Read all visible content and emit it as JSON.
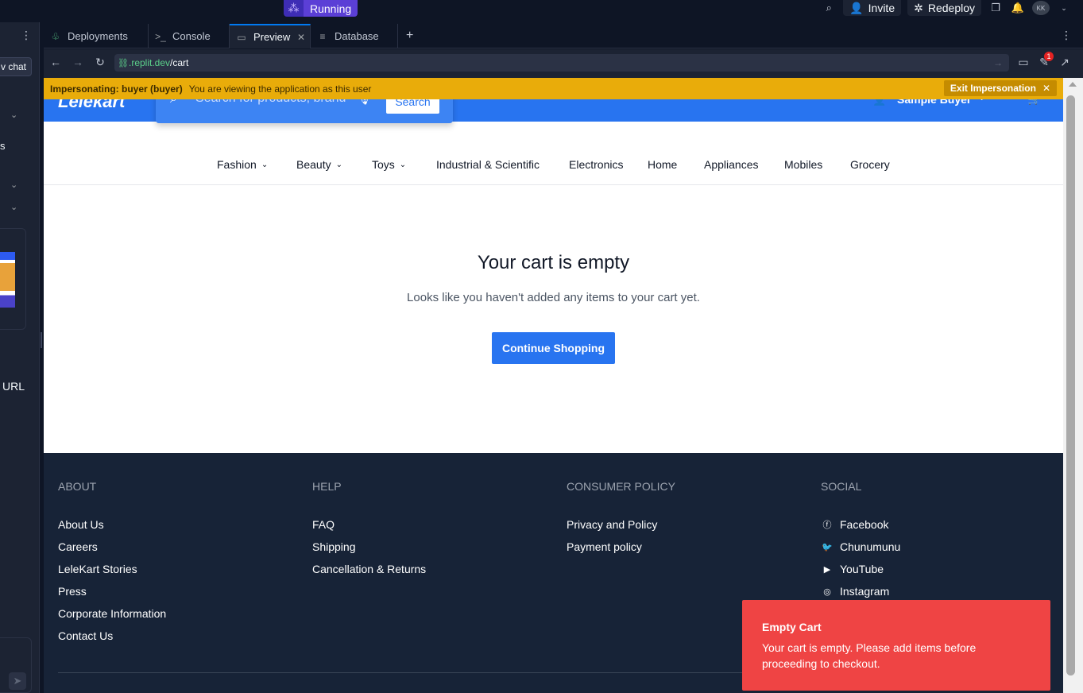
{
  "topbar": {
    "run_label": "Running",
    "invite_label": "Invite",
    "redeploy_label": "Redeploy",
    "avatar_initials": "KK"
  },
  "leftpanel": {
    "chat_label": "v chat",
    "s_label": "s",
    "url_label": "URL"
  },
  "tabs": [
    {
      "label": "Deployments"
    },
    {
      "label": "Console"
    },
    {
      "label": "Preview"
    },
    {
      "label": "Database"
    }
  ],
  "urlbar": {
    "host": ".replit.dev",
    "path": "/cart",
    "badge_count": "1"
  },
  "impersonation": {
    "label": "Impersonating: buyer (buyer)",
    "message": "You are viewing the application as this user",
    "exit_label": "Exit Impersonation"
  },
  "site": {
    "logo": "Lelekart",
    "search_placeholder": "Search for products, brand",
    "search_button": "Search",
    "user_name": "Sample Buyer",
    "categories": [
      {
        "label": "Fashion",
        "dropdown": true
      },
      {
        "label": "Beauty",
        "dropdown": true
      },
      {
        "label": "Toys",
        "dropdown": true
      },
      {
        "label": "Industrial & Scientific",
        "dropdown": false
      },
      {
        "label": "Electronics",
        "dropdown": false
      },
      {
        "label": "Home",
        "dropdown": false
      },
      {
        "label": "Appliances",
        "dropdown": false
      },
      {
        "label": "Mobiles",
        "dropdown": false
      },
      {
        "label": "Grocery",
        "dropdown": false
      }
    ]
  },
  "cart": {
    "title": "Your cart is empty",
    "subtitle": "Looks like you haven't added any items to your cart yet.",
    "cta": "Continue Shopping"
  },
  "footer": {
    "about": {
      "heading": "ABOUT",
      "links": [
        "About Us",
        "Careers",
        "LeleKart Stories",
        "Press",
        "Corporate Information",
        "Contact Us"
      ]
    },
    "help": {
      "heading": "HELP",
      "links": [
        "FAQ",
        "Shipping",
        "Cancellation & Returns"
      ]
    },
    "policy": {
      "heading": "CONSUMER POLICY",
      "links": [
        "Privacy and Policy",
        "Payment policy"
      ]
    },
    "social": {
      "heading": "SOCIAL",
      "links": [
        "Facebook",
        "Chunumunu",
        "YouTube",
        "Instagram"
      ]
    }
  },
  "toast": {
    "title": "Empty Cart",
    "message": "Your cart is empty. Please add items before proceeding to checkout."
  },
  "colors": {
    "brand_blue": "#2874f0",
    "impersonation_yellow": "#e9ac0a",
    "toast_red": "#ef4444",
    "footer_bg": "#172337"
  }
}
